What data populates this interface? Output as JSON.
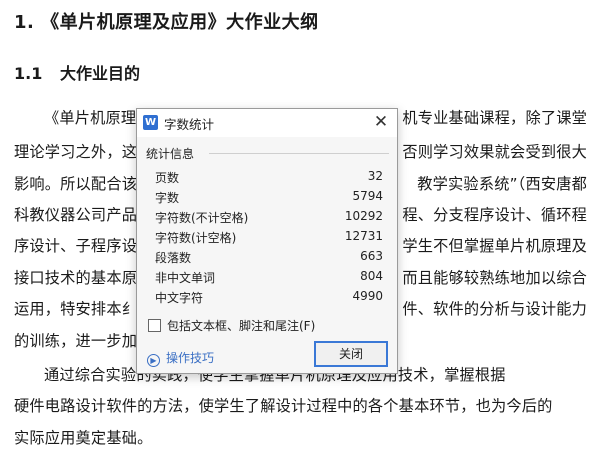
{
  "document": {
    "heading1": "1. 《单片机原理及应用》大作业大纲",
    "heading2_number": "1.1",
    "heading2_text": "大作业目的",
    "lines_left": [
      "《单片机原理",
      "理论学习之外，这",
      "影响。所以配合该",
      "科教仪器公司产品",
      "序设计、子程序设",
      "接口技术的基本原",
      "运用，特安排本纟",
      "的训练，进一步加"
    ],
    "lines_right": [
      "机专业基础课程，除了课堂",
      "否则学习效果就会受到很大",
      "教学实验系统”（西安唐都",
      "程、分支程序设计、循环程",
      "学生不但掌握单片机原理及",
      "而且能够较熟练地加以综合",
      "件、软件的分析与设计能力"
    ],
    "line_9": "通过综合实验的实践，使学生掌握单片机原理及应用技术，掌握根据",
    "line_10": "硬件电路设计软件的方法，使学生了解设计过程中的各个基本环节，也为今后的",
    "line_11": "实际应用奠定基础。"
  },
  "dialog": {
    "app_icon": "W",
    "title": "字数统计",
    "group_label": "统计信息",
    "stats": [
      {
        "label": "页数",
        "value": "32"
      },
      {
        "label": "字数",
        "value": "5794"
      },
      {
        "label": "字符数(不计空格)",
        "value": "10292"
      },
      {
        "label": "字符数(计空格)",
        "value": "12731"
      },
      {
        "label": "段落数",
        "value": "663"
      },
      {
        "label": "非中文单词",
        "value": "804"
      },
      {
        "label": "中文字符",
        "value": "4990"
      }
    ],
    "checkbox_label": "包括文本框、脚注和尾注(F)",
    "checkbox_checked": false,
    "tips_label": "操作技巧",
    "close_button": "关闭",
    "accent_color": "#3a78d6"
  }
}
